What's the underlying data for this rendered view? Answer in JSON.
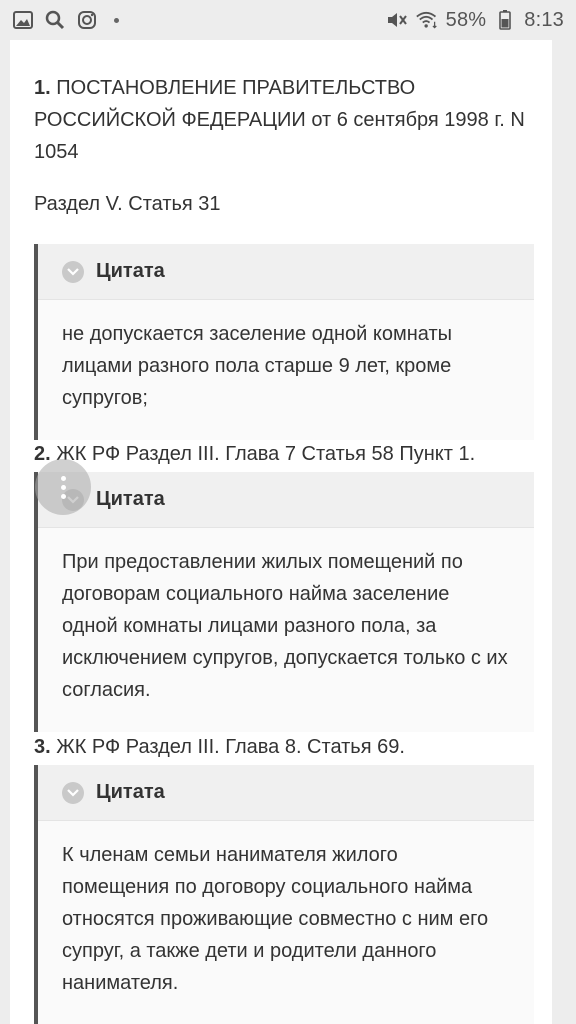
{
  "status_bar": {
    "icons_left": [
      "image-icon",
      "search-icon",
      "instagram-icon",
      "dot-icon"
    ],
    "icons_right": [
      "mute-icon",
      "wifi-icon",
      "battery-icon"
    ],
    "battery": "58%",
    "time": "8:13"
  },
  "document": {
    "num1": "1.",
    "title": "ПОСТАНОВЛЕНИЕ ПРАВИТЕЛЬСТВО РОССИЙСКОЙ ФЕДЕРАЦИИ от 6 сентября 1998 г. N 1054",
    "section": "Раздел V. Статья 31"
  },
  "quotes": [
    {
      "label": "Цитата",
      "text": "не допускается заселение одной комнаты лицами разного пола старше 9 лет, кроме супругов;"
    },
    {
      "label": "Цитата",
      "text": "При предоставлении жилых помещений по договорам социального найма заселение одной комнаты лицами разного пола, за исключением супругов, допускается только с их согласия."
    },
    {
      "label": "Цитата",
      "text": "К членам семьи нанимателя жилого помещения по договору социального найма относятся проживающие совместно с ним его супруг, а также дети и родители данного нанимателя."
    }
  ],
  "items": [
    {
      "num": "2.",
      "text": "ЖК РФ Раздел III. Глава 7 Статья 58 Пункт 1."
    },
    {
      "num": "3.",
      "text": "ЖК РФ Раздел III. Глава 8. Статья 69."
    }
  ],
  "fab": {
    "icon": "more-vertical-icon"
  }
}
